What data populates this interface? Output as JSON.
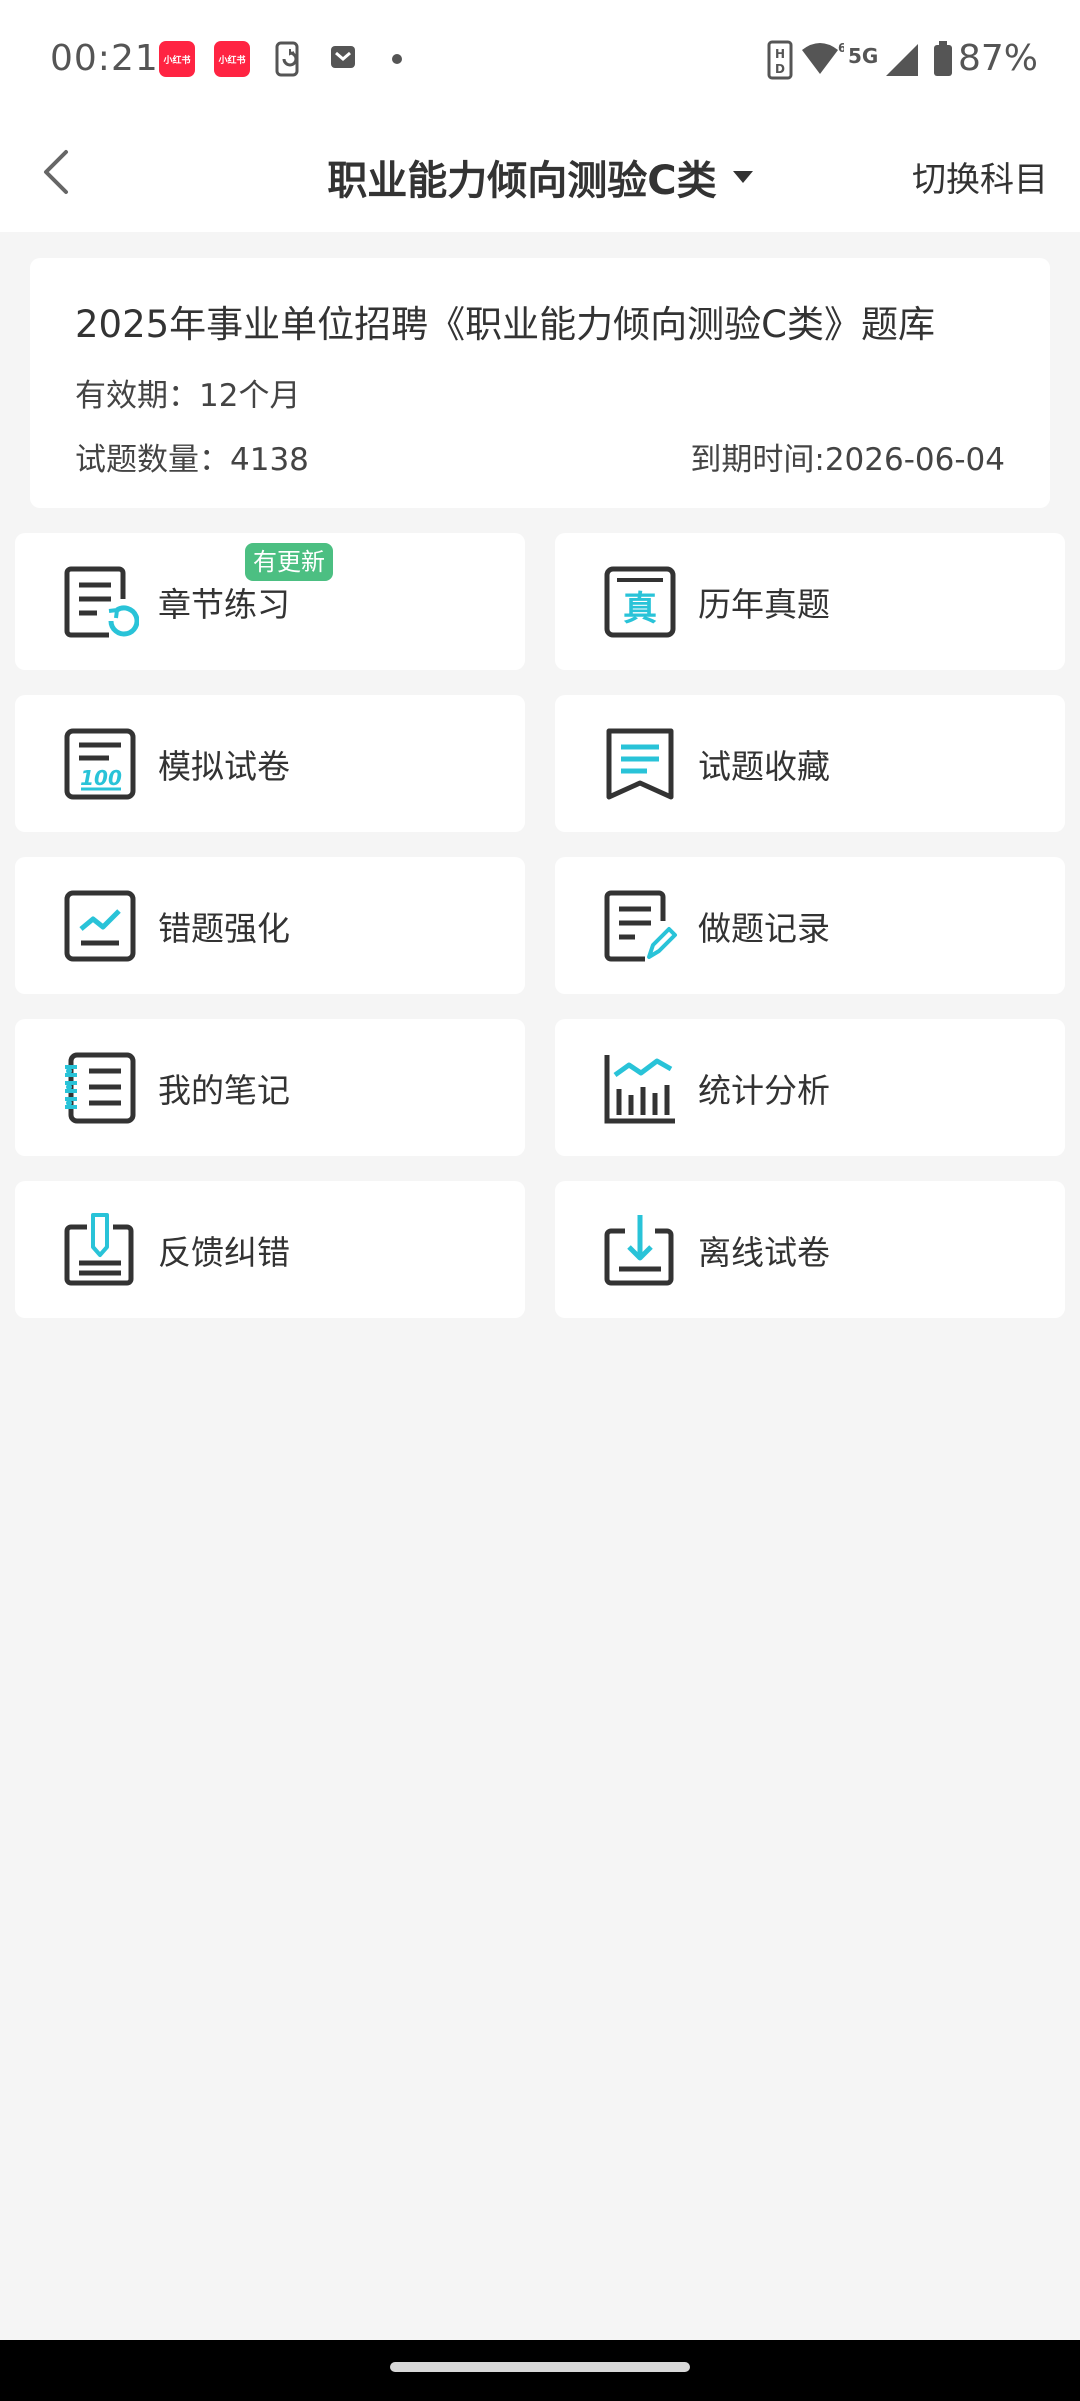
{
  "status_bar": {
    "time": "00:21",
    "app_badge_text": "小红书",
    "network": "5G",
    "battery": "87%"
  },
  "nav": {
    "title": "职业能力倾向测验C类",
    "switch_label": "切换科目"
  },
  "info_card": {
    "title": "2025年事业单位招聘《职业能力倾向测验C类》题库",
    "validity": "有效期：12个月",
    "count": "试题数量：4138",
    "expiry": "到期时间:2026-06-04"
  },
  "menu": {
    "items": [
      {
        "label": "章节练习",
        "icon": "chapter-practice-icon",
        "badge": "有更新"
      },
      {
        "label": "历年真题",
        "icon": "past-exams-icon"
      },
      {
        "label": "模拟试卷",
        "icon": "mock-paper-icon"
      },
      {
        "label": "试题收藏",
        "icon": "bookmark-icon"
      },
      {
        "label": "错题强化",
        "icon": "wrong-questions-icon"
      },
      {
        "label": "做题记录",
        "icon": "record-icon"
      },
      {
        "label": "我的笔记",
        "icon": "notes-icon"
      },
      {
        "label": "统计分析",
        "icon": "statistics-icon"
      },
      {
        "label": "反馈纠错",
        "icon": "feedback-icon"
      },
      {
        "label": "离线试卷",
        "icon": "download-icon"
      }
    ]
  },
  "colors": {
    "accent": "#29c3d8",
    "icon_stroke": "#333333",
    "badge": "#4cbf82",
    "background": "#f5f5f5"
  }
}
